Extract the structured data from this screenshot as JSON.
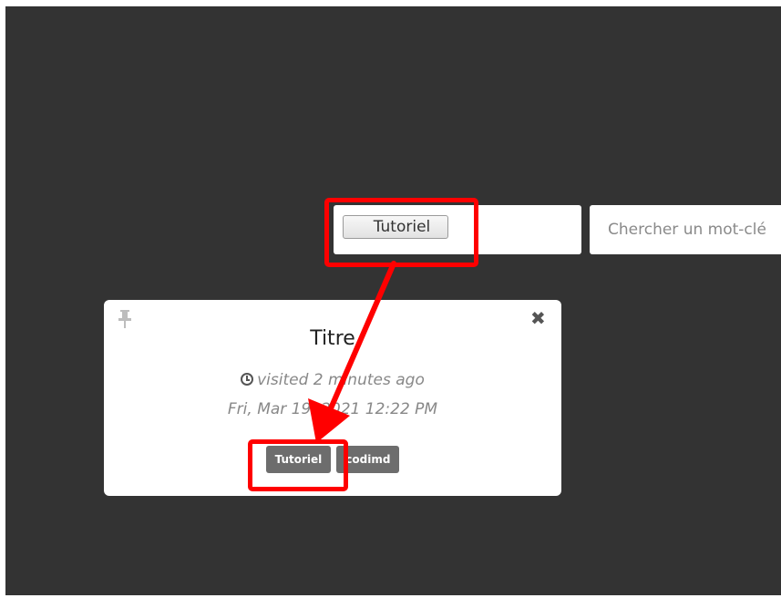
{
  "filter": {
    "tag_label": "Tutoriel"
  },
  "search": {
    "placeholder": "Chercher un mot-clé"
  },
  "card": {
    "title": "Titre",
    "visited": "visited 2 minutes ago",
    "date": "Fri, Mar 19, 2021 12:22 PM",
    "tags": [
      "Tutoriel",
      "codimd"
    ]
  },
  "icons": {
    "pin": "pin-icon",
    "close": "close-icon",
    "clock": "clock-icon"
  },
  "colors": {
    "background": "#333333",
    "annotation": "#ff0000",
    "tag": "#6d6d6d"
  }
}
